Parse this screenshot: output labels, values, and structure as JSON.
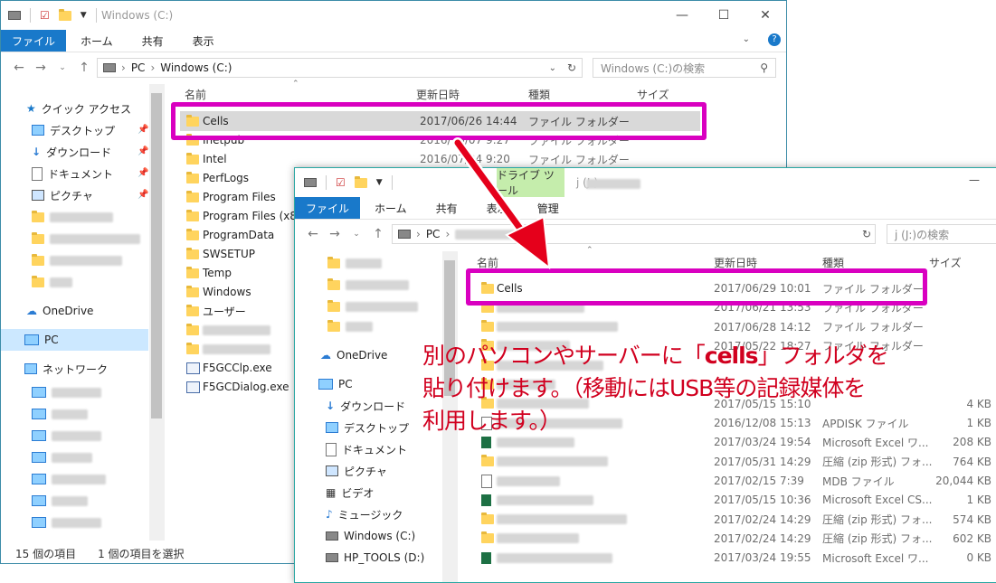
{
  "win1": {
    "title": "Windows (C:)",
    "ribbon_tabs": [
      "ファイル",
      "ホーム",
      "共有",
      "表示"
    ],
    "breadcrumb": [
      "PC",
      "Windows (C:)"
    ],
    "search_placeholder": "Windows (C:)の検索",
    "nav": {
      "quick_access": "クイック アクセス",
      "desktop": "デスクトップ",
      "downloads": "ダウンロード",
      "documents": "ドキュメント",
      "pictures": "ピクチャ",
      "onedrive": "OneDrive",
      "pc": "PC",
      "network": "ネットワーク"
    },
    "columns": {
      "name": "名前",
      "date": "更新日時",
      "type": "種類",
      "size": "サイズ"
    },
    "rows": [
      {
        "name": "Cells",
        "date": "2017/06/26 14:44",
        "type": "ファイル フォルダー"
      },
      {
        "name": "Inetpub",
        "date": "2016/10/07 9:27",
        "type": "ファイル フォルダー"
      },
      {
        "name": "Intel",
        "date": "2016/07/04 9:20",
        "type": "ファイル フォルダー"
      },
      {
        "name": "PerfLogs",
        "date": "",
        "type": ""
      },
      {
        "name": "Program Files",
        "date": "",
        "type": ""
      },
      {
        "name": "Program Files (x86)",
        "date": "",
        "type": ""
      },
      {
        "name": "ProgramData",
        "date": "",
        "type": ""
      },
      {
        "name": "SWSETUP",
        "date": "",
        "type": ""
      },
      {
        "name": "Temp",
        "date": "",
        "type": ""
      },
      {
        "name": "Windows",
        "date": "",
        "type": ""
      },
      {
        "name": "ユーザー",
        "date": "",
        "type": ""
      },
      {
        "name": "",
        "date": "",
        "type": ""
      },
      {
        "name": "",
        "date": "",
        "type": ""
      },
      {
        "name": "F5GCClp.exe",
        "date": "",
        "type": ""
      },
      {
        "name": "F5GCDialog.exe",
        "date": "",
        "type": ""
      }
    ],
    "status_count": "15 個の項目",
    "status_selected": "1 個の項目を選択"
  },
  "win2": {
    "title": "j (J:)",
    "drive_tools": "ドライブ ツール",
    "ribbon_tabs": [
      "ファイル",
      "ホーム",
      "共有",
      "表示",
      "管理"
    ],
    "breadcrumb": [
      "PC"
    ],
    "search_placeholder": "j (J:)の検索",
    "nav": {
      "onedrive": "OneDrive",
      "pc": "PC",
      "downloads": "ダウンロード",
      "desktop": "デスクトップ",
      "documents": "ドキュメント",
      "pictures": "ピクチャ",
      "videos": "ビデオ",
      "music": "ミュージック",
      "windows_c": "Windows (C:)",
      "hp_tools": "HP_TOOLS (D:)"
    },
    "columns": {
      "name": "名前",
      "date": "更新日時",
      "type": "種類",
      "size": "サイズ"
    },
    "rows": [
      {
        "name": "Cells",
        "date": "2017/06/29 10:01",
        "type": "ファイル フォルダー",
        "size": "",
        "icon": "folder"
      },
      {
        "name": "",
        "date": "2017/06/21 13:53",
        "type": "ファイル フォルダー",
        "size": "",
        "icon": "folder"
      },
      {
        "name": "",
        "date": "2017/06/28 14:12",
        "type": "ファイル フォルダー",
        "size": "",
        "icon": "folder"
      },
      {
        "name": "",
        "date": "2017/05/22 18:27",
        "type": "ファイル フォルダー",
        "size": "",
        "icon": "folder"
      },
      {
        "name": "",
        "date": "",
        "type": "",
        "size": "",
        "icon": "folder"
      },
      {
        "name": "",
        "date": "",
        "type": "",
        "size": "",
        "icon": "folder"
      },
      {
        "name": "",
        "date": "2017/05/15 15:10",
        "type": "",
        "size": "4 KB",
        "icon": "folder"
      },
      {
        "name": "",
        "date": "2016/12/08 15:13",
        "type": "APDISK ファイル",
        "size": "1 KB",
        "icon": "doc"
      },
      {
        "name": "",
        "date": "2017/03/24 19:54",
        "type": "Microsoft Excel ワ...",
        "size": "208 KB",
        "icon": "xl"
      },
      {
        "name": "",
        "date": "2017/05/31 14:29",
        "type": "圧縮 (zip 形式) フォ...",
        "size": "764 KB",
        "icon": "folder"
      },
      {
        "name": "",
        "date": "2017/02/15 7:39",
        "type": "MDB ファイル",
        "size": "20,044 KB",
        "icon": "doc"
      },
      {
        "name": "",
        "date": "2017/05/15 10:36",
        "type": "Microsoft Excel CS...",
        "size": "1 KB",
        "icon": "xl"
      },
      {
        "name": "",
        "date": "2017/02/24 14:29",
        "type": "圧縮 (zip 形式) フォ...",
        "size": "574 KB",
        "icon": "folder"
      },
      {
        "name": "",
        "date": "2017/02/24 14:29",
        "type": "圧縮 (zip 形式) フォ...",
        "size": "602 KB",
        "icon": "folder"
      },
      {
        "name": "",
        "date": "2017/03/24 19:55",
        "type": "Microsoft Excel ワ...",
        "size": "0 KB",
        "icon": "xl"
      }
    ]
  },
  "callout": {
    "line1_pre": "別のパソコンやサーバーに「",
    "line1_bold": "cells",
    "line1_post": "」フォルダを",
    "line2": "貼り付けます。（移動にはUSB等の記録媒体を",
    "line3": "利用します。）"
  },
  "colors": {
    "highlight": "#d900c0",
    "callout": "#d1001f",
    "arrow": "#e5001b",
    "accent": "#1979ca"
  }
}
